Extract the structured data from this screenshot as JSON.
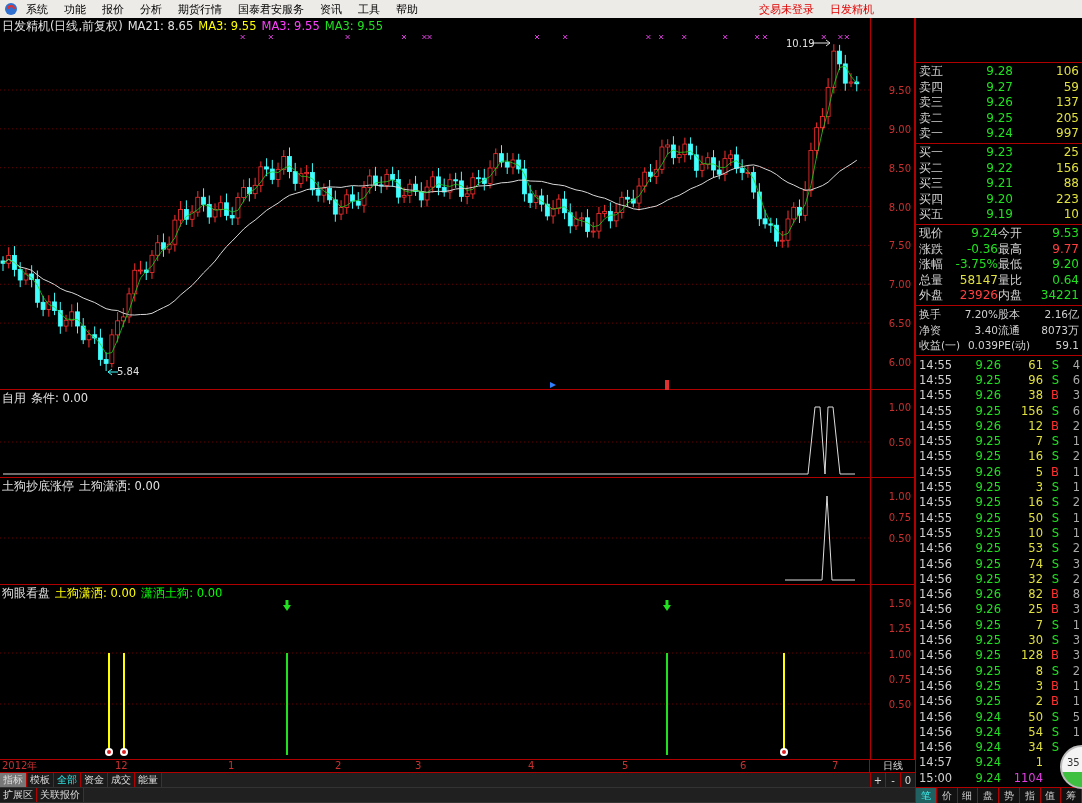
{
  "menu": {
    "items": [
      "系统",
      "功能",
      "报价",
      "分析",
      "期货行情",
      "国泰君安服务",
      "资讯",
      "工具",
      "帮助"
    ],
    "status": [
      "交易未登录",
      "日发精机"
    ]
  },
  "main_chart": {
    "title": "日发精机(日线,前复权)",
    "indicators": [
      {
        "label": "MA21: 8.65",
        "color": "#e0e0e0"
      },
      {
        "label": "MA3: 9.55",
        "color": "#ffff00"
      },
      {
        "label": "MA3: 9.55",
        "color": "#ff40ff"
      },
      {
        "label": "MA3: 9.55",
        "color": "#20e020"
      }
    ],
    "high_label": "10.19",
    "low_label": "5.84",
    "axis_ticks": [
      "9.50",
      "9.00",
      "8.50",
      "8.00",
      "7.50",
      "7.00",
      "6.50",
      "6.00"
    ]
  },
  "panes": [
    {
      "title": "自用",
      "values": [
        {
          "label": "条件: 0.00",
          "color": "#e0e0e0"
        }
      ],
      "axis_ticks": [
        "1.00",
        "0.50"
      ]
    },
    {
      "title": "土狗抄底涨停",
      "values": [
        {
          "label": "土狗潇洒: 0.00",
          "color": "#e0e0e0"
        }
      ],
      "axis_ticks": [
        "1.00",
        "0.75",
        "0.50"
      ]
    },
    {
      "title": "狗眼看盘",
      "values": [
        {
          "label": "土狗潇洒: 0.00",
          "color": "#ffff00"
        },
        {
          "label": "潇洒土狗: 0.00",
          "color": "#00ff00"
        }
      ],
      "axis_ticks": [
        "1.50",
        "1.25",
        "1.00",
        "0.75",
        "0.50"
      ]
    }
  ],
  "date_axis": {
    "labels": [
      "2012年",
      "12",
      "1",
      "2",
      "3",
      "4",
      "5",
      "6",
      "7"
    ],
    "period": "日线"
  },
  "indicator_tabs": [
    {
      "label": "指标",
      "selected": true
    },
    {
      "label": "模板",
      "selected": false
    }
  ],
  "filter_tabs": [
    {
      "label": "全部",
      "selected": true
    },
    {
      "label": "资金",
      "selected": false
    },
    {
      "label": "成交",
      "selected": false
    },
    {
      "label": "能量",
      "selected": false
    }
  ],
  "zoom_buttons": [
    "+",
    "-",
    "0"
  ],
  "bottom_tabs": [
    "扩展区",
    "关联报价"
  ],
  "quote": {
    "asks": [
      {
        "label": "卖五",
        "price": "9.28",
        "volume": "106"
      },
      {
        "label": "卖四",
        "price": "9.27",
        "volume": "59"
      },
      {
        "label": "卖三",
        "price": "9.26",
        "volume": "137"
      },
      {
        "label": "卖二",
        "price": "9.25",
        "volume": "205"
      },
      {
        "label": "卖一",
        "price": "9.24",
        "volume": "997"
      }
    ],
    "bids": [
      {
        "label": "买一",
        "price": "9.23",
        "volume": "25"
      },
      {
        "label": "买二",
        "price": "9.22",
        "volume": "156"
      },
      {
        "label": "买三",
        "price": "9.21",
        "volume": "88"
      },
      {
        "label": "买四",
        "price": "9.20",
        "volume": "223"
      },
      {
        "label": "买五",
        "price": "9.19",
        "volume": "10"
      }
    ],
    "stats": [
      [
        {
          "label": "现价",
          "value": "9.24",
          "color": "#20e020"
        },
        {
          "label": "今开",
          "value": "9.53",
          "color": "#20e020"
        }
      ],
      [
        {
          "label": "涨跌",
          "value": "-0.36",
          "color": "#20e020"
        },
        {
          "label": "最高",
          "value": "9.77",
          "color": "#ff4040"
        }
      ],
      [
        {
          "label": "涨幅",
          "value": "-3.75%",
          "color": "#20e020"
        },
        {
          "label": "最低",
          "value": "9.20",
          "color": "#20e020"
        }
      ],
      [
        {
          "label": "总量",
          "value": "58147",
          "color": "#e0e040"
        },
        {
          "label": "量比",
          "value": "0.64",
          "color": "#20e020"
        }
      ],
      [
        {
          "label": "外盘",
          "value": "23926",
          "color": "#ff4040"
        },
        {
          "label": "内盘",
          "value": "34221",
          "color": "#20e020"
        }
      ]
    ],
    "finance": [
      [
        {
          "label": "换手",
          "value": "7.20%"
        },
        {
          "label": "股本",
          "value": "2.16亿"
        }
      ],
      [
        {
          "label": "净资",
          "value": "3.40"
        },
        {
          "label": "流通",
          "value": "8073万"
        }
      ],
      [
        {
          "label": "收益(一)",
          "value": "0.039"
        },
        {
          "label": "PE(动)",
          "value": "59.1"
        }
      ]
    ]
  },
  "trades": [
    {
      "time": "14:55",
      "price": "9.26",
      "volume": "61",
      "side": "S",
      "kind": "sell",
      "count": "4"
    },
    {
      "time": "14:55",
      "price": "9.25",
      "volume": "96",
      "side": "S",
      "kind": "sell",
      "count": "6"
    },
    {
      "time": "14:55",
      "price": "9.26",
      "volume": "38",
      "side": "B",
      "kind": "buy",
      "count": "3"
    },
    {
      "time": "14:55",
      "price": "9.25",
      "volume": "156",
      "side": "S",
      "kind": "sell",
      "count": "6"
    },
    {
      "time": "14:55",
      "price": "9.26",
      "volume": "12",
      "side": "B",
      "kind": "buy",
      "count": "2"
    },
    {
      "time": "14:55",
      "price": "9.25",
      "volume": "7",
      "side": "S",
      "kind": "sell",
      "count": "1"
    },
    {
      "time": "14:55",
      "price": "9.25",
      "volume": "16",
      "side": "S",
      "kind": "sell",
      "count": "2"
    },
    {
      "time": "14:55",
      "price": "9.26",
      "volume": "5",
      "side": "B",
      "kind": "buy",
      "count": "1"
    },
    {
      "time": "14:55",
      "price": "9.25",
      "volume": "3",
      "side": "S",
      "kind": "sell",
      "count": "1"
    },
    {
      "time": "14:55",
      "price": "9.25",
      "volume": "16",
      "side": "S",
      "kind": "sell",
      "count": "2"
    },
    {
      "time": "14:55",
      "price": "9.25",
      "volume": "50",
      "side": "S",
      "kind": "sell",
      "count": "1"
    },
    {
      "time": "14:55",
      "price": "9.25",
      "volume": "10",
      "side": "S",
      "kind": "sell",
      "count": "1"
    },
    {
      "time": "14:56",
      "price": "9.25",
      "volume": "53",
      "side": "S",
      "kind": "sell",
      "count": "2"
    },
    {
      "time": "14:56",
      "price": "9.25",
      "volume": "74",
      "side": "S",
      "kind": "sell",
      "count": "3"
    },
    {
      "time": "14:56",
      "price": "9.25",
      "volume": "32",
      "side": "S",
      "kind": "sell",
      "count": "2"
    },
    {
      "time": "14:56",
      "price": "9.26",
      "volume": "82",
      "side": "B",
      "kind": "buy",
      "count": "8"
    },
    {
      "time": "14:56",
      "price": "9.26",
      "volume": "25",
      "side": "B",
      "kind": "buy",
      "count": "3"
    },
    {
      "time": "14:56",
      "price": "9.25",
      "volume": "7",
      "side": "S",
      "kind": "sell",
      "count": "1"
    },
    {
      "time": "14:56",
      "price": "9.25",
      "volume": "30",
      "side": "S",
      "kind": "sell",
      "count": "3"
    },
    {
      "time": "14:56",
      "price": "9.25",
      "volume": "128",
      "side": "B",
      "kind": "buy",
      "count": "3"
    },
    {
      "time": "14:56",
      "price": "9.25",
      "volume": "8",
      "side": "S",
      "kind": "sell",
      "count": "2"
    },
    {
      "time": "14:56",
      "price": "9.25",
      "volume": "3",
      "side": "B",
      "kind": "buy",
      "count": "1"
    },
    {
      "time": "14:56",
      "price": "9.25",
      "volume": "2",
      "side": "B",
      "kind": "buy",
      "count": "1"
    },
    {
      "time": "14:56",
      "price": "9.24",
      "volume": "50",
      "side": "S",
      "kind": "sell",
      "count": "5"
    },
    {
      "time": "14:56",
      "price": "9.24",
      "volume": "54",
      "side": "S",
      "kind": "sell",
      "count": "1"
    },
    {
      "time": "14:56",
      "price": "9.24",
      "volume": "34",
      "side": "S",
      "kind": "sell"
    },
    {
      "time": "14:57",
      "price": "9.24",
      "volume": "1",
      "kind": "neutral"
    },
    {
      "time": "15:00",
      "price": "9.24",
      "volume": "1104",
      "kind": "closing"
    }
  ],
  "detail_tabs": [
    {
      "label": "笔",
      "selected": true
    },
    {
      "label": "价",
      "selected": false
    },
    {
      "label": "细",
      "selected": false
    },
    {
      "label": "盘",
      "selected": false
    },
    {
      "label": "势",
      "selected": false
    },
    {
      "label": "指",
      "selected": false
    },
    {
      "label": "值",
      "selected": false
    },
    {
      "label": "筹",
      "selected": false
    }
  ],
  "float_widget": {
    "text": "35"
  }
}
